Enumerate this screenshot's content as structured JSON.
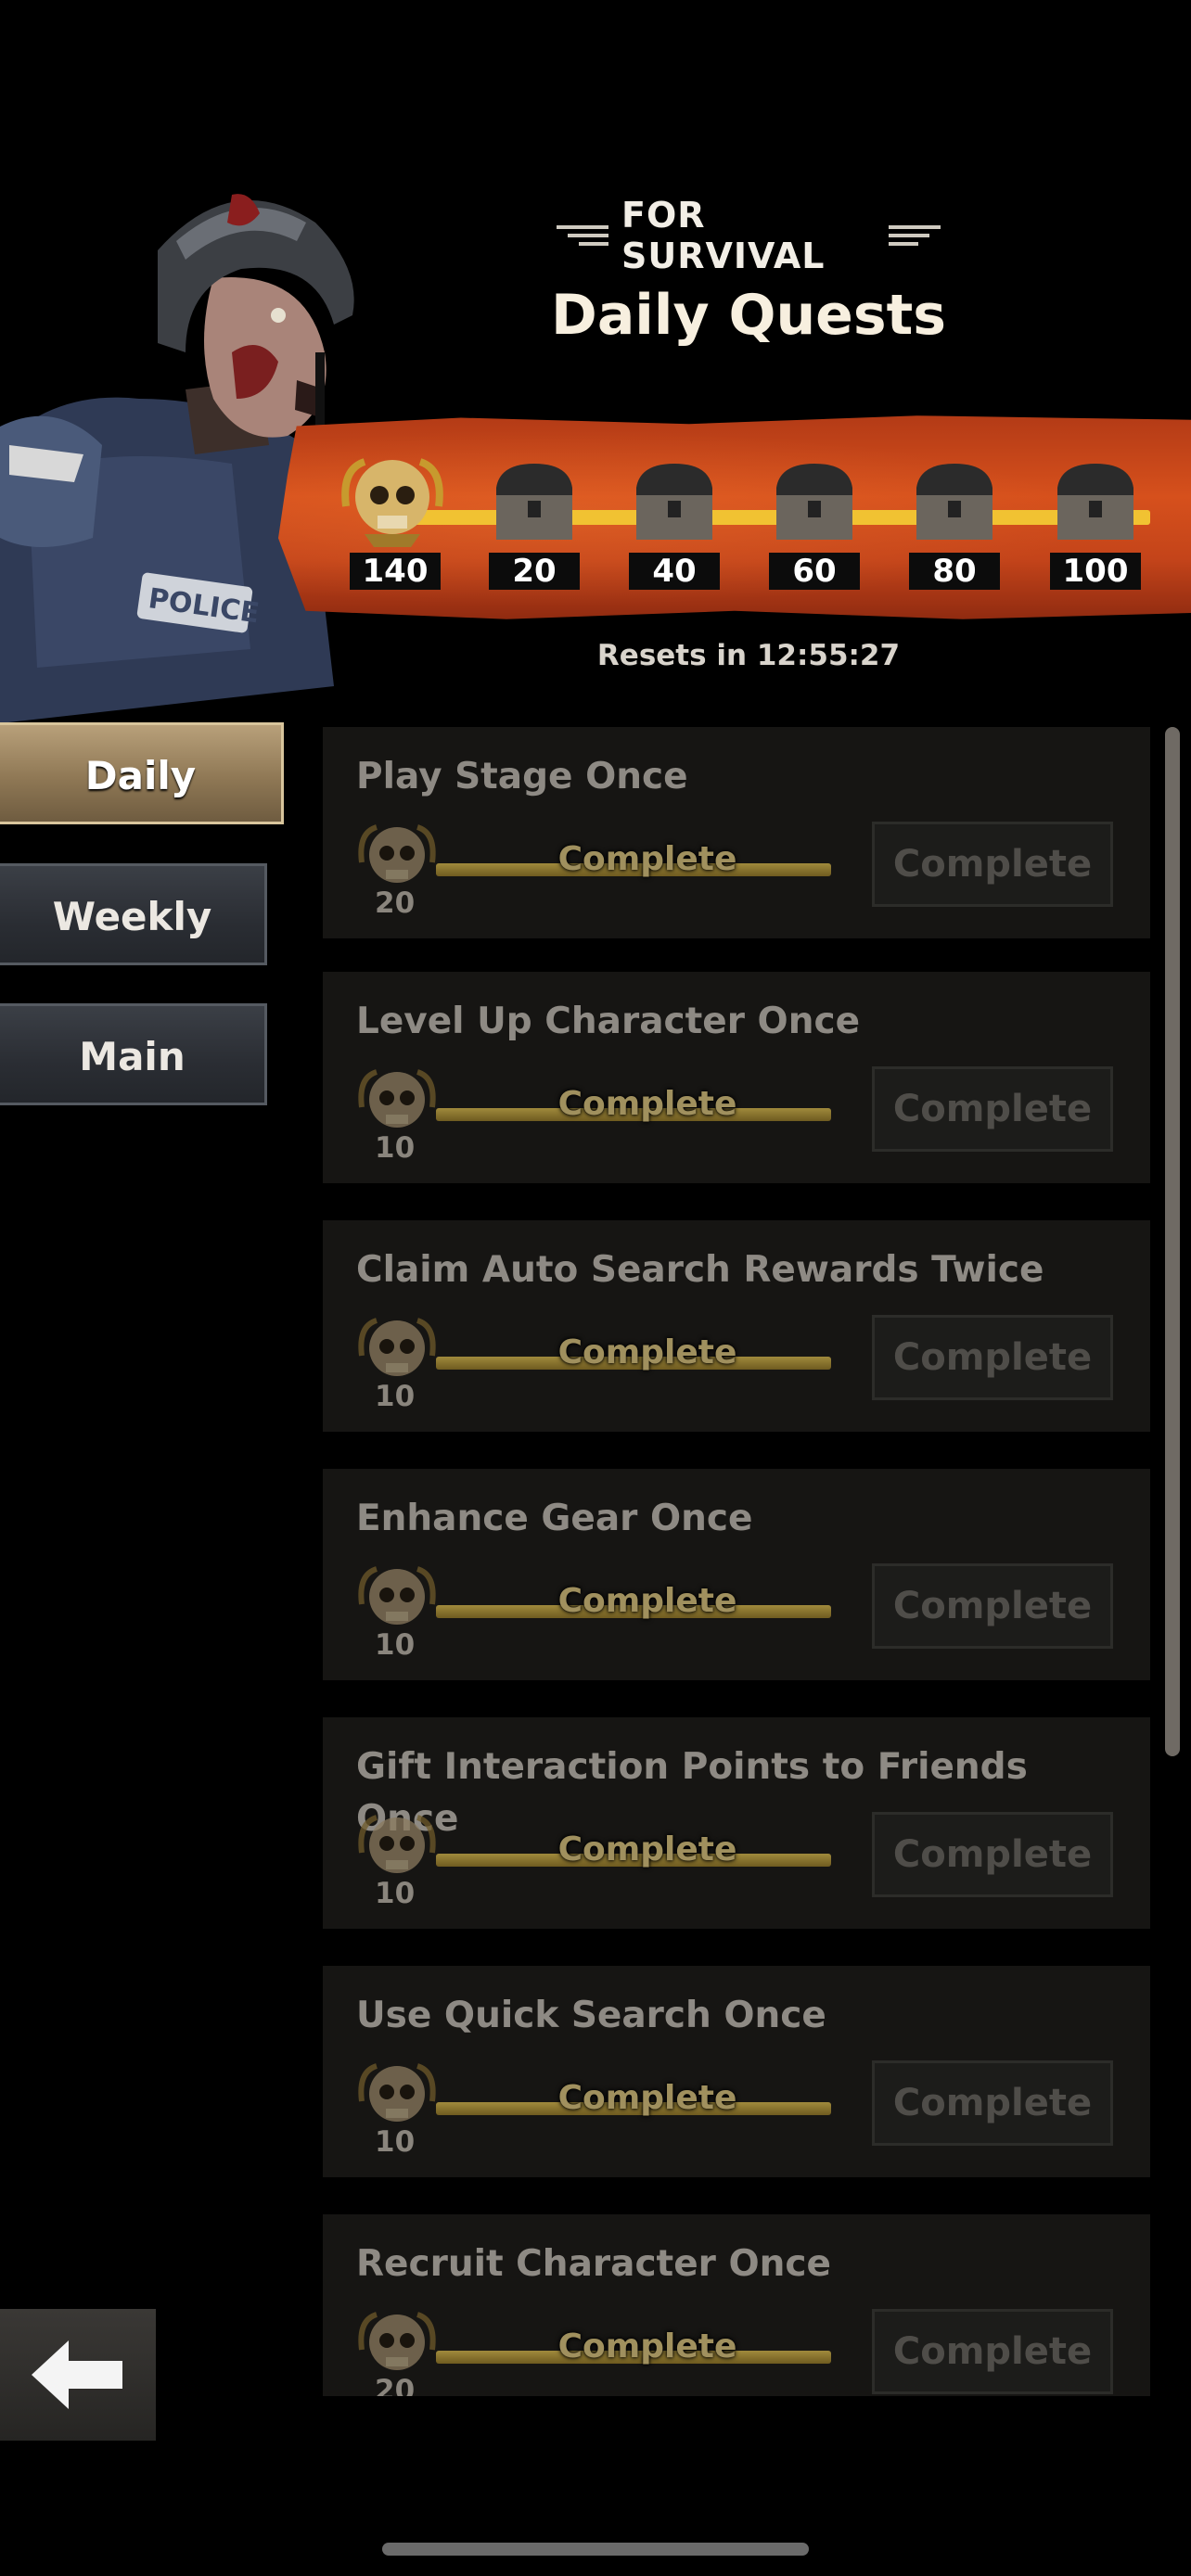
{
  "header": {
    "subtitle": "FOR SURVIVAL",
    "title": "Daily Quests",
    "resets_text": "Resets in 12:55:27"
  },
  "progress": {
    "current_points": "140",
    "milestones": [
      "20",
      "40",
      "60",
      "80",
      "100"
    ]
  },
  "tabs": [
    {
      "label": "Daily",
      "active": true
    },
    {
      "label": "Weekly",
      "active": false
    },
    {
      "label": "Main",
      "active": false
    }
  ],
  "quests": [
    {
      "title": "Play Stage Once",
      "reward": "20",
      "progress_label": "Complete",
      "button_label": "Complete"
    },
    {
      "title": "Level Up Character Once",
      "reward": "10",
      "progress_label": "Complete",
      "button_label": "Complete"
    },
    {
      "title": "Claim Auto Search Rewards Twice",
      "reward": "10",
      "progress_label": "Complete",
      "button_label": "Complete"
    },
    {
      "title": "Enhance Gear Once",
      "reward": "10",
      "progress_label": "Complete",
      "button_label": "Complete"
    },
    {
      "title": "Gift Interaction Points to Friends Once",
      "reward": "10",
      "progress_label": "Complete",
      "button_label": "Complete"
    },
    {
      "title": "Use Quick Search Once",
      "reward": "10",
      "progress_label": "Complete",
      "button_label": "Complete"
    },
    {
      "title": "Recruit Character Once",
      "reward": "20",
      "progress_label": "Complete",
      "button_label": "Complete"
    }
  ],
  "icons": {
    "back": "back-arrow-icon",
    "reward": "skull-medal-icon",
    "milestone": "chest-icon"
  },
  "colors": {
    "banner": "#d6501c",
    "track": "#f1c232",
    "active_tab": "#8f7855"
  }
}
